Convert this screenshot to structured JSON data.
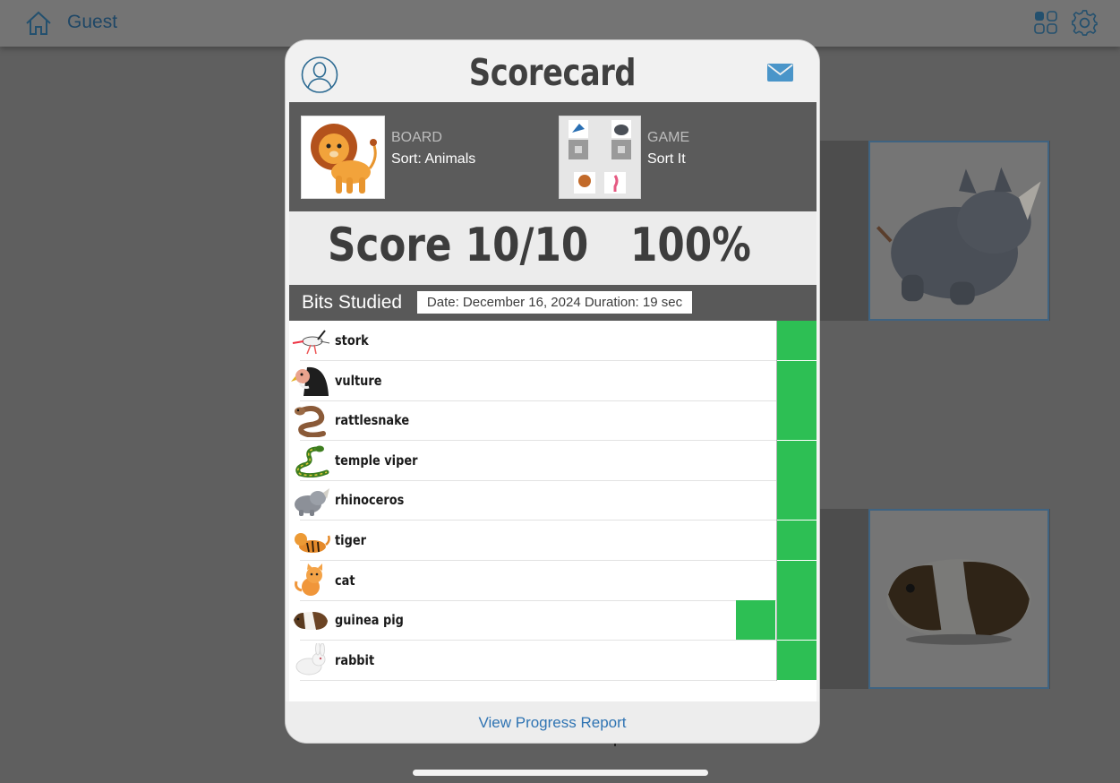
{
  "app": {
    "user_name": "Guest",
    "icons": [
      "home-icon",
      "grid-icon",
      "gear-icon"
    ]
  },
  "scorecard": {
    "title": "Scorecard",
    "icons": {
      "avatar": "user-avatar-icon",
      "mail": "mail-icon"
    },
    "board": {
      "label": "BOARD",
      "value": "Sort: Animals",
      "thumbnail": "lion"
    },
    "game": {
      "label": "GAME",
      "value": "Sort It"
    },
    "score": {
      "text": "Score 10/10",
      "percent": "100%"
    },
    "bits_title": "Bits Studied",
    "session": "Date: December 16, 2024 Duration: 19 sec",
    "items": [
      {
        "label": "stork",
        "icon": "stork-icon",
        "correct_cells": 1
      },
      {
        "label": "vulture",
        "icon": "vulture-icon",
        "correct_cells": 1
      },
      {
        "label": "rattlesnake",
        "icon": "rattlesnake-icon",
        "correct_cells": 1
      },
      {
        "label": "temple viper",
        "icon": "temple-viper-icon",
        "correct_cells": 1
      },
      {
        "label": "rhinoceros",
        "icon": "rhinoceros-icon",
        "correct_cells": 1
      },
      {
        "label": "tiger",
        "icon": "tiger-icon",
        "correct_cells": 1
      },
      {
        "label": "cat",
        "icon": "cat-icon",
        "correct_cells": 1
      },
      {
        "label": "guinea pig",
        "icon": "guinea-pig-icon",
        "correct_cells": 2
      },
      {
        "label": "rabbit",
        "icon": "rabbit-icon",
        "correct_cells": 1
      }
    ],
    "result_color": "#2dbf54",
    "footer_link": "View Progress Report"
  },
  "colors": {
    "accent": "#2f74b3",
    "header_text": "#1f4766"
  }
}
